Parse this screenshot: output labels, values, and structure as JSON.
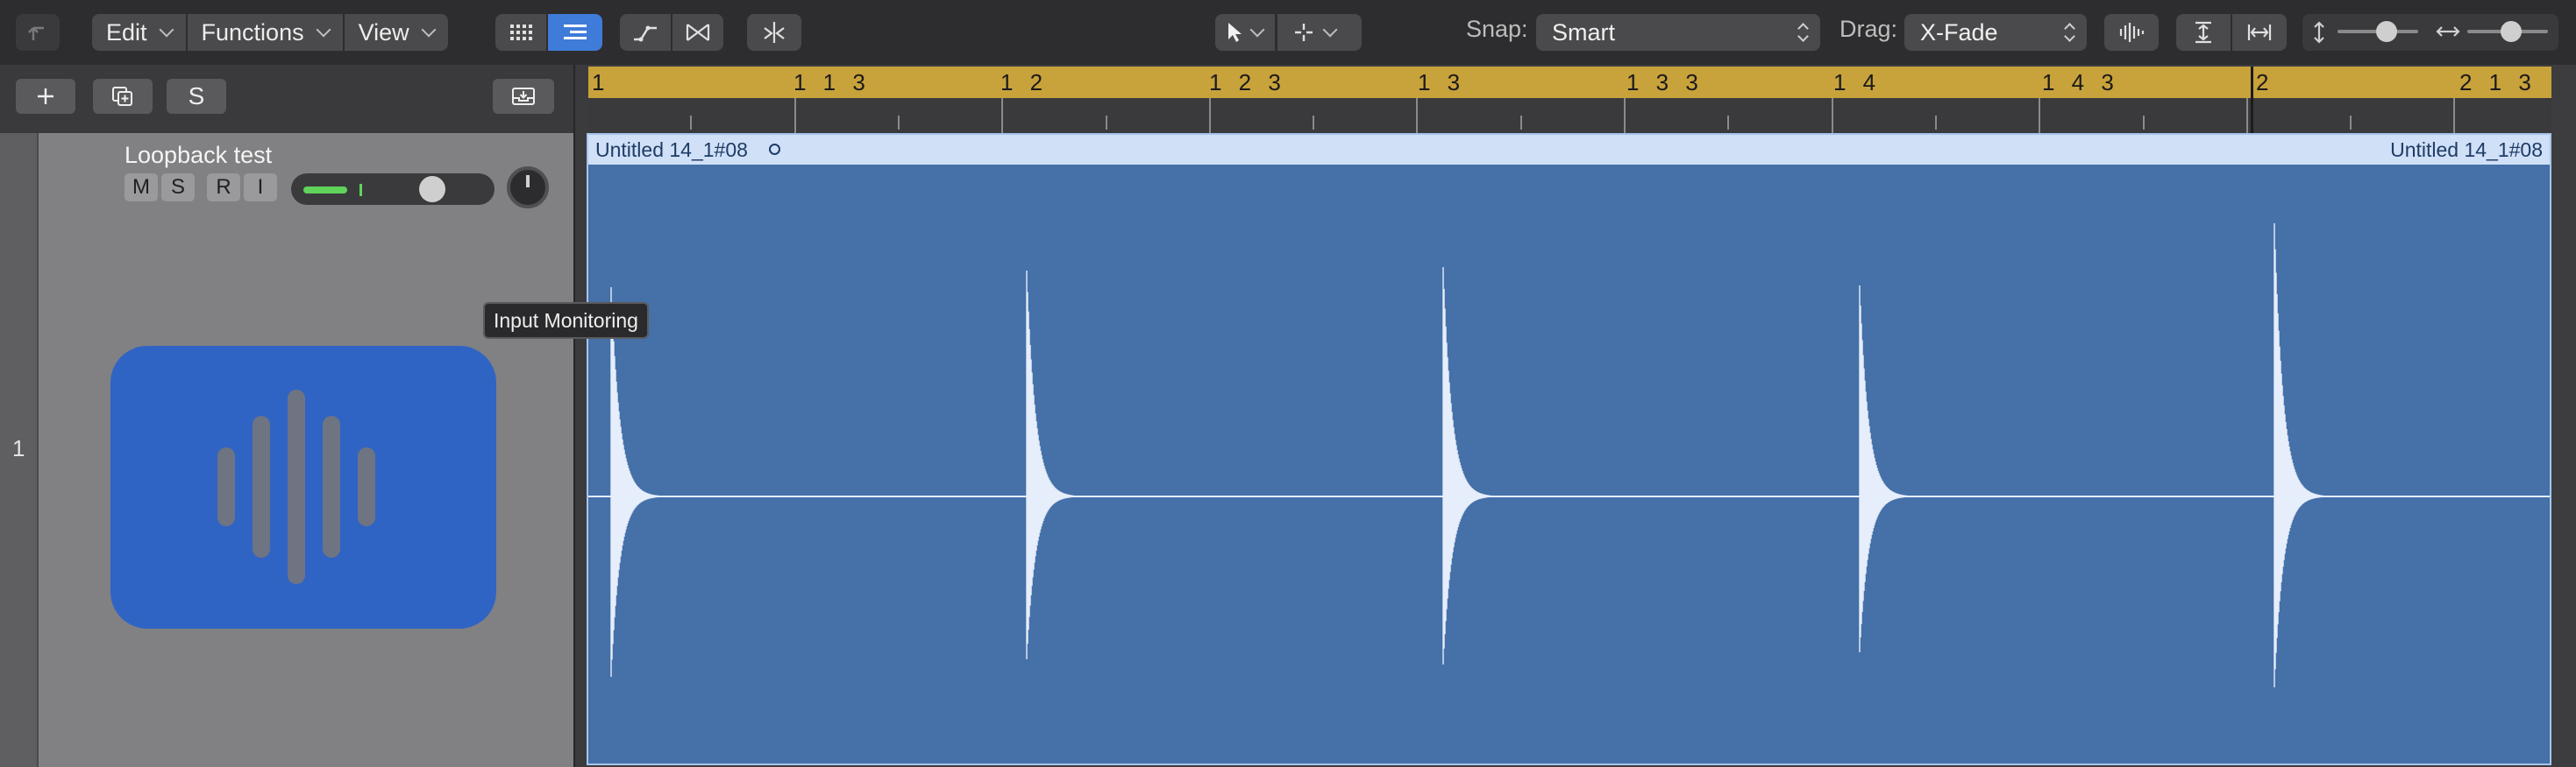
{
  "toolbar": {
    "menus": [
      {
        "label": "Edit"
      },
      {
        "label": "Functions"
      },
      {
        "label": "View"
      }
    ],
    "snap_label": "Snap:",
    "snap_value": "Smart",
    "drag_label": "Drag:",
    "drag_value": "X-Fade"
  },
  "track_tools": {
    "solo_label": "S"
  },
  "ruler": {
    "marks": [
      "1",
      "1 1 3",
      "1 2",
      "1 2 3",
      "1 3",
      "1 3 3",
      "1 4",
      "1 4 3",
      "2",
      "2 1 3"
    ]
  },
  "track": {
    "number": "1",
    "name": "Loopback test",
    "buttons": [
      "M",
      "S",
      "R",
      "I"
    ],
    "volume_level": 0.2
  },
  "tooltip": {
    "text": "Input Monitoring"
  },
  "region": {
    "name_left": "Untitled 14_1#08",
    "name_right": "Untitled 14_1#08",
    "color": "#4570a8"
  },
  "colors": {
    "accent": "#3f7bd9",
    "ruler": "#c8a23a",
    "region_header": "#cfe0f7"
  }
}
